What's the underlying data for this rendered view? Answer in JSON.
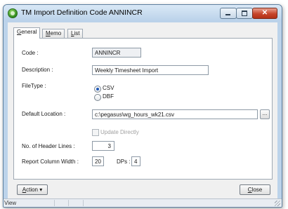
{
  "window": {
    "title": "TM Import Definition Code ANNINCR"
  },
  "tabs": [
    {
      "prefix": "",
      "accel": "G",
      "rest": "eneral"
    },
    {
      "prefix": "",
      "accel": "M",
      "rest": "emo"
    },
    {
      "prefix": "",
      "accel": "L",
      "rest": "ist"
    }
  ],
  "form": {
    "code_label": "Code :",
    "code_value": "ANNINCR",
    "description_label": "Description :",
    "description_value": "Weekly Timesheet Import",
    "filetype_label": "FileType :",
    "filetype_options": [
      "CSV",
      "DBF"
    ],
    "filetype_selected": "CSV",
    "default_location_label": "Default Location :",
    "default_location_value": "c:\\pegasus\\wg_hours_wk21.csv",
    "browse_label": "...",
    "update_directly_label": "Update Directly",
    "update_directly_checked": false,
    "header_lines_label": "No. of Header Lines :",
    "header_lines_value": "3",
    "report_col_width_label": "Report Column Width :",
    "report_col_width_value": "20",
    "dps_label": "DPs :",
    "dps_value": "4"
  },
  "footer": {
    "action_accel": "A",
    "action_rest": "ction",
    "action_arrow": "▾",
    "close_accel": "C",
    "close_rest": "lose"
  },
  "status": {
    "text": "View"
  },
  "icons": {
    "app": "app-icon",
    "minimize": "minimize-icon",
    "maximize": "maximize-icon",
    "close": "close-icon",
    "resize": "resize-grip-icon"
  }
}
